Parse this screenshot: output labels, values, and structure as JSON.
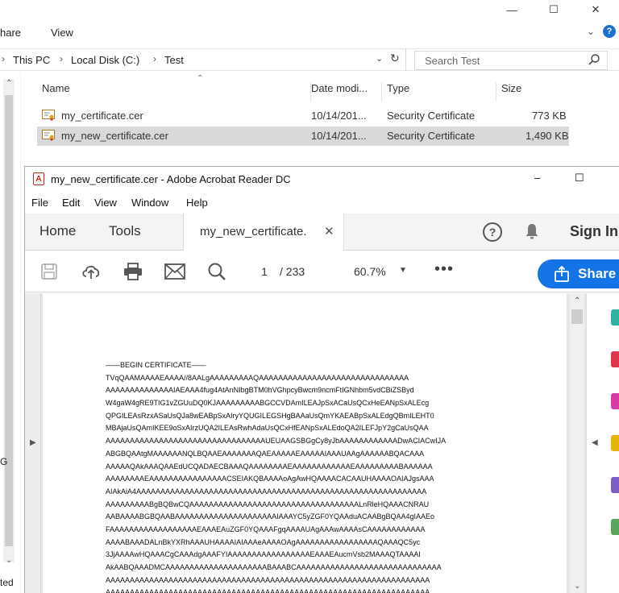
{
  "explorer": {
    "window_controls": {
      "minimize": "—",
      "maximize": "☐",
      "close": "✕"
    },
    "ribbon": {
      "share_tab": "hare",
      "view_tab": "View",
      "help": "?"
    },
    "breadcrumb": [
      "This PC",
      "Local Disk (C:)",
      "Test"
    ],
    "search_placeholder": "Search Test",
    "columns": {
      "name": "Name",
      "date": "Date modi...",
      "type": "Type",
      "size": "Size"
    },
    "files": [
      {
        "name": "my_certificate.cer",
        "date": "10/14/201...",
        "type": "Security Certificate",
        "size": "773 KB",
        "selected": false
      },
      {
        "name": "my_new_certificate.cer",
        "date": "10/14/201...",
        "type": "Security Certificate",
        "size": "1,490 KB",
        "selected": true
      }
    ],
    "side_partial": {
      "g": "G",
      "ted": "ted"
    }
  },
  "acrobat": {
    "title": "my_new_certificate.cer - Adobe Acrobat Reader DC",
    "title_controls": {
      "minimize": "–",
      "maximize": "☐"
    },
    "menu": [
      "File",
      "Edit",
      "View",
      "Window",
      "Help"
    ],
    "tabs": {
      "home": "Home",
      "tools": "Tools",
      "document": "my_new_certificate.",
      "close": "✕"
    },
    "help": "?",
    "sign_in": "Sign In",
    "toolbar": {
      "page_current": "1",
      "page_total": "/  233",
      "zoom": "60.7%",
      "more": "•••",
      "share": "Share"
    },
    "certificate_lines": [
      "——BEGIN CERTIFICATE——",
      "TVqQAAMAAAAEAAAA//8AALgAAAAAAAAAQAAAAAAAAAAAAAAAAAAAAAAAAAAAAAAA",
      "AAAAAAAAAAAAAAIAEAAA4fug4AtAnNIbgBTM0hVGhpcyBwcm9ncmFtIGNhbm5vdCBiZSByd",
      "W4gaW4gRE9TIG1vZGUuDQ0KJAAAAAAAAABGCCVDAmILEAJpSxACaUsQCxHeEANpSxALEcg",
      "QPGILEAsRzxASaUsQJa8wEABpSxAIryYQUGILEGSHgBAAaUsQmYKAEABpSxALEdgQBmILEHT0",
      "MBAjaUsQAmIKEE9oSxAIrzUQA2ILEAsRwhAdaUsQCxHfEANpSxALEdoQA2ILEFJpY2gCaUsQAA",
      "AAAAAAAAAAAAAAAAAAAAAAAAAAAAAAAAAUEUAAGSBGgCy8yJbAAAAAAAAAAAADwACIACwIJA",
      "ABGBQAAtgMAAAAAANQLBQAAEAAAAAAAQAEAAAAAEAAAAAIAAAUAAgAAAAAABQACAAA",
      "AAAAAQAkAAAQAAEdUCQADAECBAAAQAAAAAAAAEAAAAAAAAAAAAEAAAAAAAAABAAAAAA",
      "AAAAAAAAEAAAAAAAAAAAAAAAACSEIAKQBAAAAoAgAwHQAAAACACAAUHAAAAOAIAJgsAAA",
      "AIAkAiA4AAAAAAAAAAAAAAAAAAAAAAAAAAAAAAAAAAAAAAAAAAAAAAAAAAAAAAAAAAAA",
      "AAAAAAAAABgBQBwCQAAAAAAAAAAAAAAAAAAAAAAAAAAAAAAAAAAALnRleHQAAACNRAU",
      "AABAAAABGBQAABAAAAAAAAAAAAAAAAAAAAAIAAAYC5yZGF0YQAAduACAABgBQAA4gIAAEo",
      "FAAAAAAAAAAAAAAAAAAEAAAEAuZGF0YQAAAFgqAAAAUAgAAAwAAAAsCAAAAAAAAAAAA",
      "AAAABAAADALnBkYXRhAAAUHAAAAIAIAAAeAAAAOAgAAAAAAAAAAAAAAAAAQAAAQC5yc",
      "3JjAAAAwHQAAACgCAAAdgAAAFYIAAAAAAAAAAAAAAAAAEAAAEAucmVsb2MAAAQTAAAAI",
      "AkAABQAAADMCAAAAAAAAAAAAAAAAAAAAABAAABCAAAAAAAAAAAAAAAAAAAAAAAAAAAAAA",
      "AAAAAAAAAAAAAAAAAAAAAAAAAAAAAAAAAAAAAAAAAAAAAAAAAAAAAAAAAAAAAAAAAAA",
      "AAAAAAAAAAAAAAAAAAAAAAAAAAAAAAAAAAAAAAAAAAAAAAAAAAAAAAAAAAAAAAAAAAA"
    ]
  },
  "colors": {
    "accent": "#1473e6",
    "pdf_red": "#d0271d",
    "selection": "#d9d9d9"
  }
}
